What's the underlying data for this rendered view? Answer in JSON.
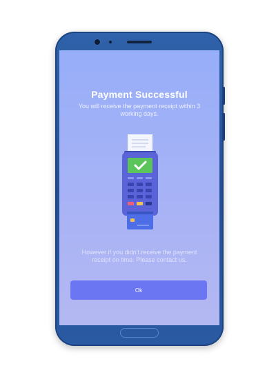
{
  "screen": {
    "title": "Payment Successful",
    "subtitle": "You will receive the payment receipt within 3 working days.",
    "note": "However if you didn't receive the payment receipt on time. Please contact us.",
    "ok_label": "Ok"
  },
  "icons": {
    "terminal": "card-terminal-icon",
    "check": "checkmark-icon",
    "receipt": "receipt-icon"
  },
  "colors": {
    "screen_top": "#97aef8",
    "screen_bottom": "#b4b8f2",
    "button": "#6b76f2",
    "success": "#5bc45b",
    "phone_body": "#2a5aa3"
  }
}
